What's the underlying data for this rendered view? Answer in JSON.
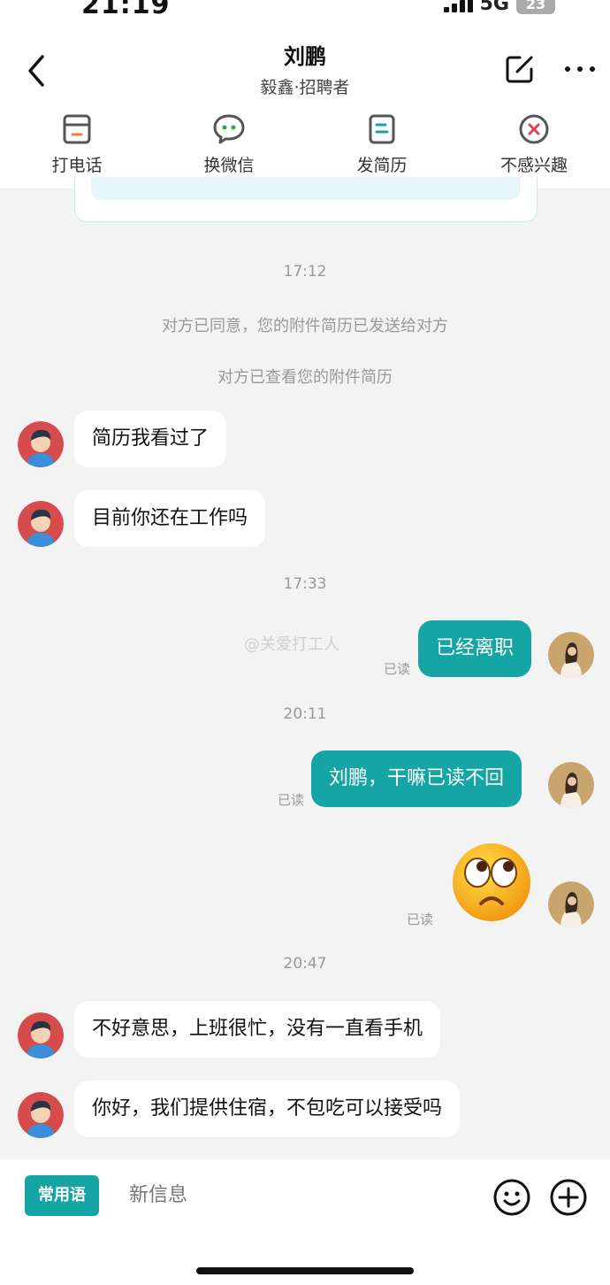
{
  "status_bar": {
    "time": "21:19",
    "network": "5G",
    "battery": "23"
  },
  "header": {
    "title": "刘鹏",
    "subtitle": "毅鑫·招聘者"
  },
  "actions": [
    {
      "label": "打电话",
      "icon": "phone-icon"
    },
    {
      "label": "换微信",
      "icon": "wechat-icon"
    },
    {
      "label": "发简历",
      "icon": "resume-icon"
    },
    {
      "label": "不感兴趣",
      "icon": "not-interested-icon"
    }
  ],
  "messages": {
    "ts1": "17:12",
    "sys1": "对方已同意，您的附件简历已发送给对方",
    "sys2": "对方已查看您的附件简历",
    "m1": "简历我看过了",
    "m2": "目前你还在工作吗",
    "ts2": "17:33",
    "m3": "已经离职",
    "ts3": "20:11",
    "m4": "刘鹏，干嘛已读不回",
    "ts4": "20:47",
    "m6": "不好意思，上班很忙，没有一直看手机",
    "m7": "你好，我们提供住宿，不包吃可以接受吗",
    "read_label": "已读",
    "watermark": "@关爱打工人"
  },
  "composer": {
    "common_phrases": "常用语",
    "placeholder": "新信息"
  },
  "colors": {
    "accent": "#16a5a5",
    "recruiter_avatar_bg": "#d64b4b",
    "danger": "#e0454b"
  }
}
